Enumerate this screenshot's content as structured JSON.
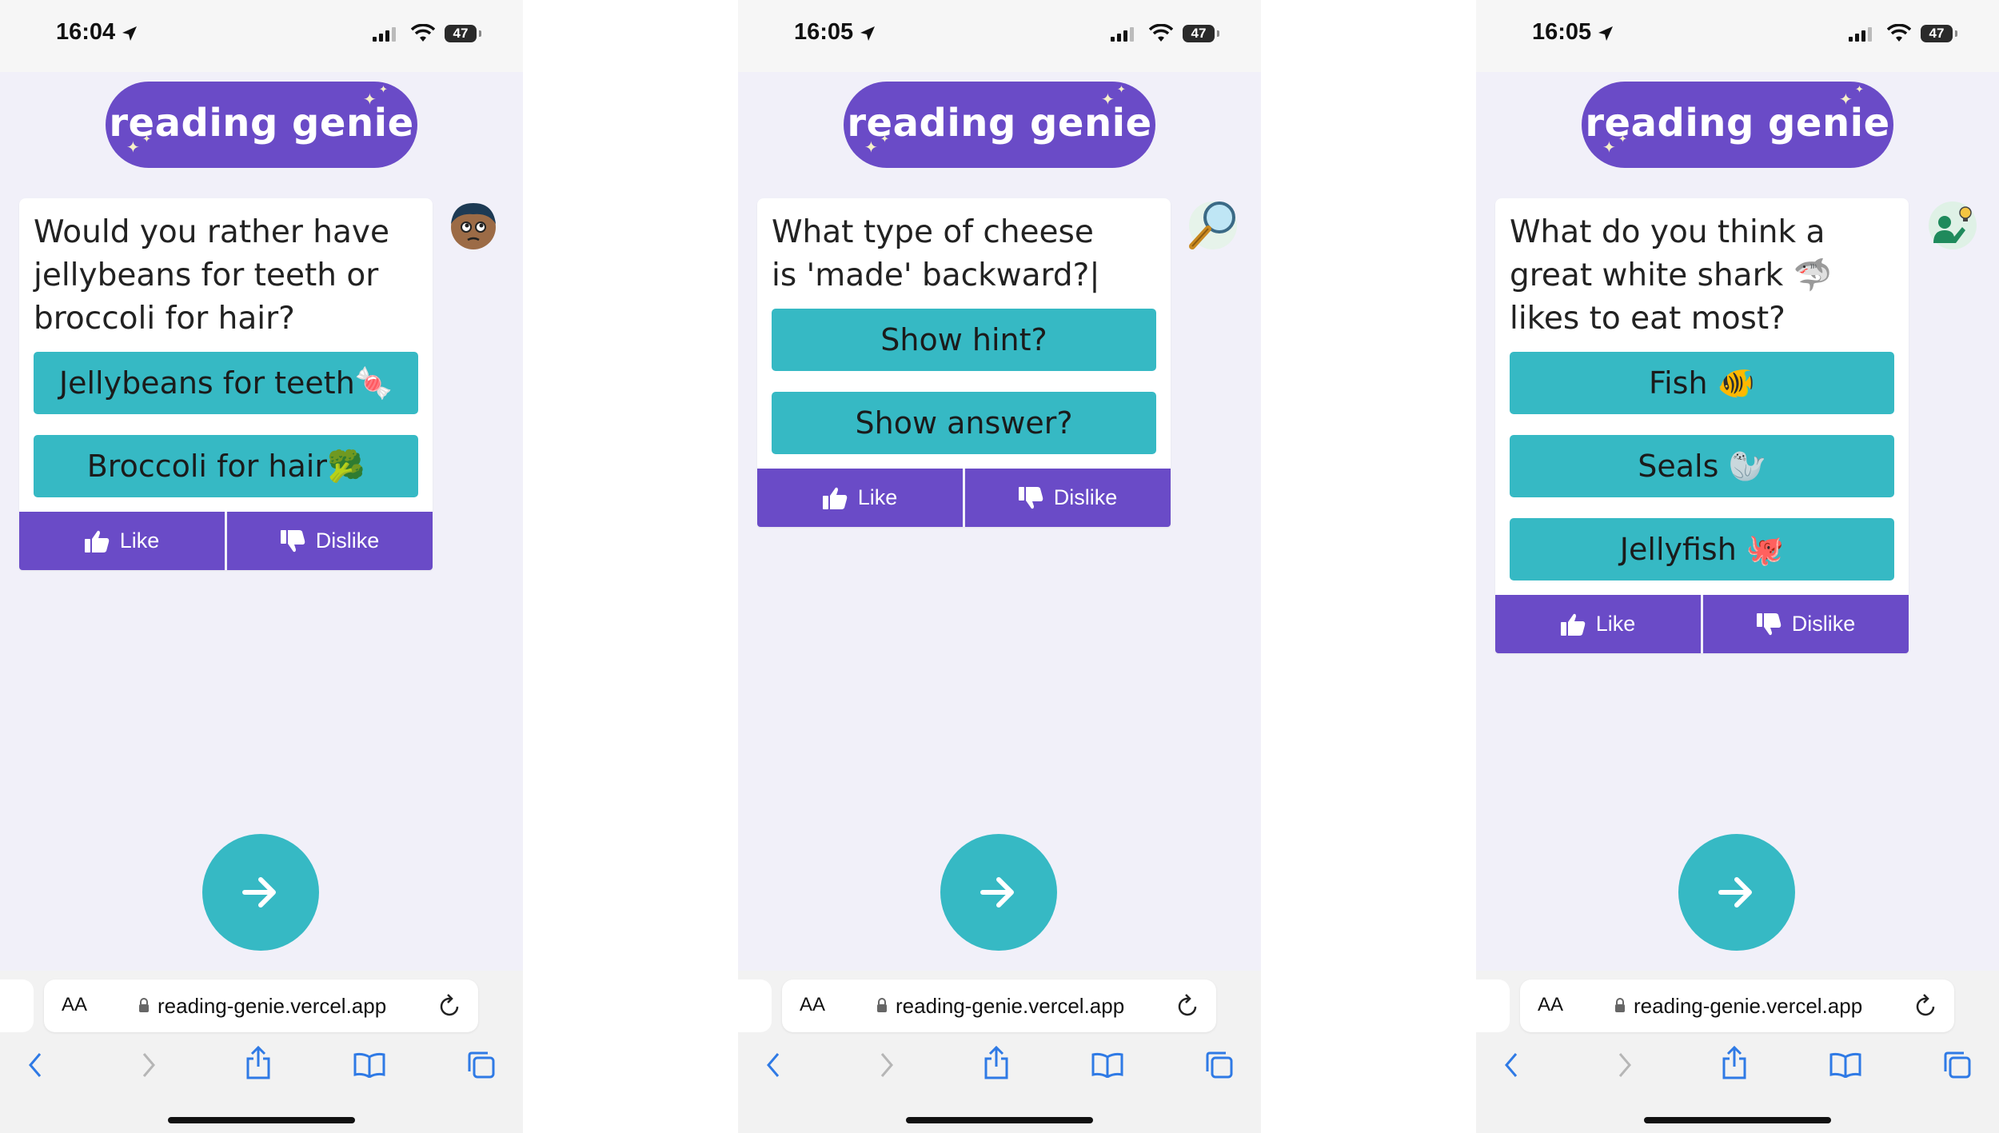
{
  "screens": [
    {
      "time": "16:04",
      "battery": "47",
      "logo": "reading genie",
      "avatar_icon": "thinking-face-avatar-icon",
      "question": "Would you rather have jellybeans for teeth or broccoli for hair?",
      "options": [
        "Jellybeans for teeth🍬",
        "Broccoli for hair🥦"
      ],
      "like": "Like",
      "dislike": "Dislike",
      "url_aa": "AA",
      "url": "reading-genie.vercel.app"
    },
    {
      "time": "16:05",
      "battery": "47",
      "logo": "reading genie",
      "avatar_icon": "magnifying-glass-icon",
      "question": "What type of cheese is 'made' backward?|",
      "options": [
        "Show hint?",
        "Show answer?"
      ],
      "like": "Like",
      "dislike": "Dislike",
      "url_aa": "AA",
      "url": "reading-genie.vercel.app"
    },
    {
      "time": "16:05",
      "battery": "47",
      "logo": "reading genie",
      "avatar_icon": "person-idea-icon",
      "question": "What do you think a great white shark 🦈 likes to eat most?",
      "options": [
        "Fish 🐠",
        "Seals 🦭",
        "Jellyfish 🐙"
      ],
      "like": "Like",
      "dislike": "Dislike",
      "url_aa": "AA",
      "url": "reading-genie.vercel.app"
    }
  ],
  "colors": {
    "brand_purple": "#6a4bc7",
    "option_teal": "#36b9c4",
    "background": "#f1f0f9"
  }
}
